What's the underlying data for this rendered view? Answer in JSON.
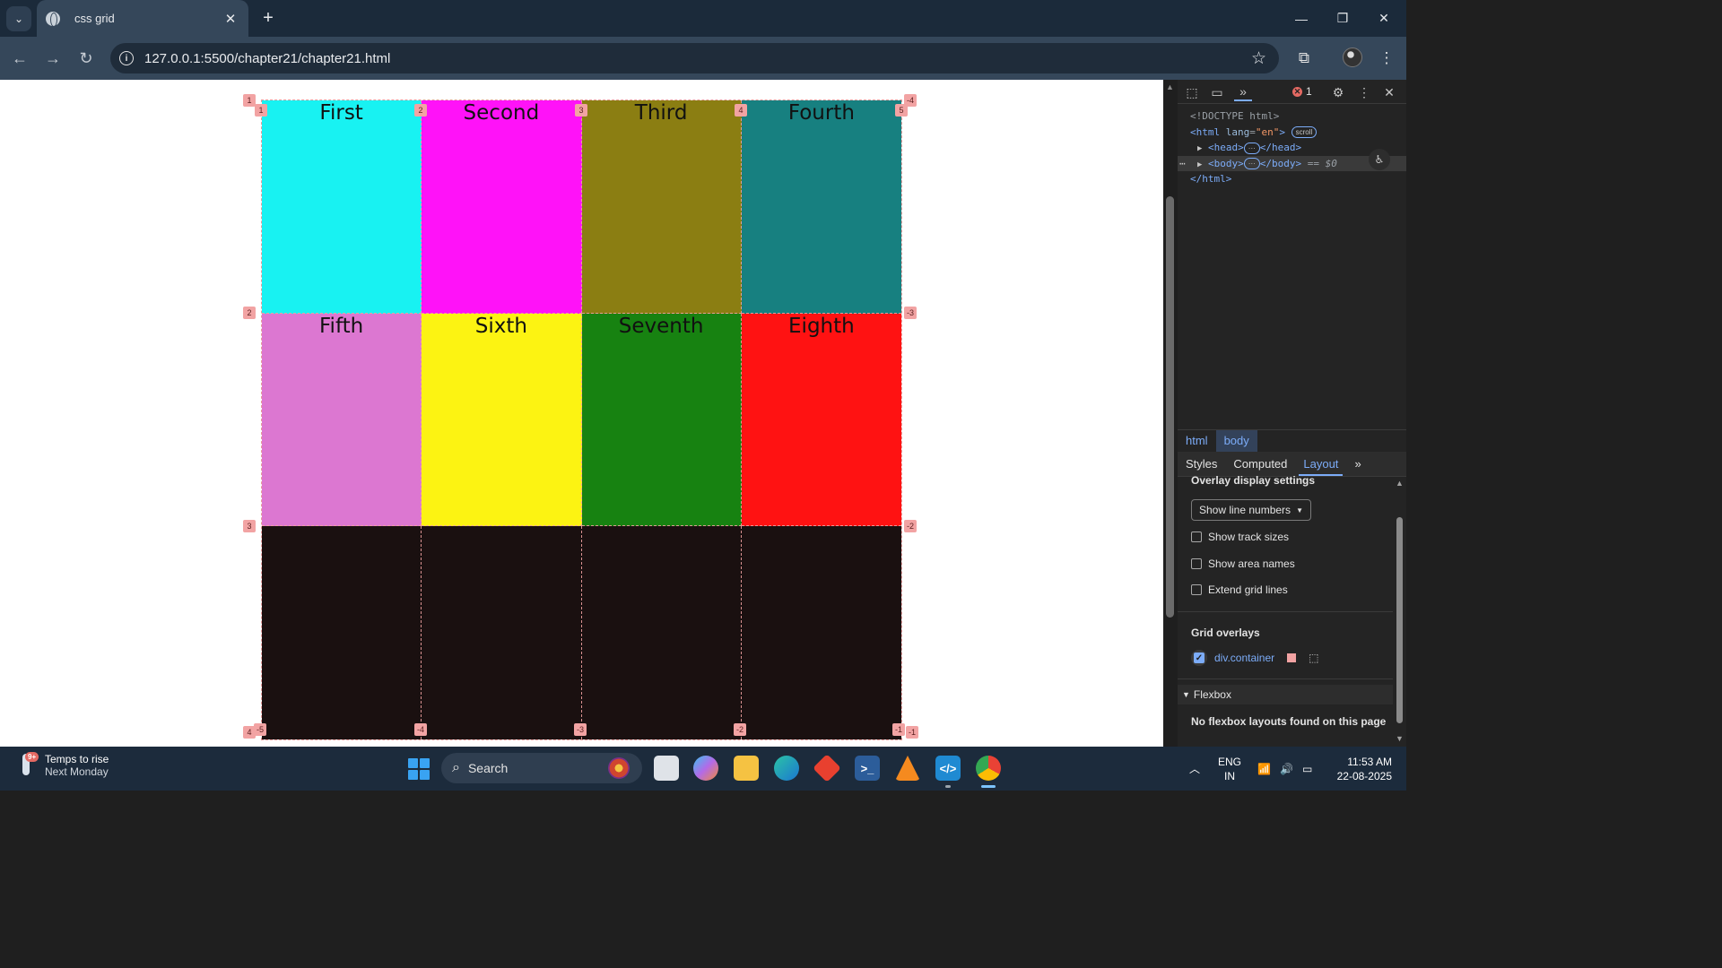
{
  "browser": {
    "tab_title": "css grid",
    "url": "127.0.0.1:5500/chapter21/chapter21.html"
  },
  "page": {
    "cells": [
      {
        "label": "First",
        "color": "#18f2f2"
      },
      {
        "label": "Second",
        "color": "#ff12f8"
      },
      {
        "label": "Third",
        "color": "#8b7e12"
      },
      {
        "label": "Fourth",
        "color": "#178080"
      },
      {
        "label": "Fifth",
        "color": "#dc77d1"
      },
      {
        "label": "Sixth",
        "color": "#fcf312"
      },
      {
        "label": "Seventh",
        "color": "#178211"
      },
      {
        "label": "Eighth",
        "color": "#ff1212"
      }
    ],
    "grid_line_labels": {
      "top_columns": [
        "1",
        "2",
        "3",
        "4",
        "5"
      ],
      "bottom_columns": [
        "-5",
        "-4",
        "-3",
        "-2",
        "-1"
      ],
      "left_rows": [
        "1",
        "2",
        "3",
        "4"
      ],
      "right_rows": [
        "-4",
        "-3",
        "-2",
        "-1"
      ]
    }
  },
  "devtools": {
    "error_count": "1",
    "dom": {
      "doctype": "<!DOCTYPE html>",
      "html_open": "<html",
      "lang_attr": "lang",
      "lang_value": "\"en\"",
      "scroll_pill": "scroll",
      "head_open": "<head>",
      "head_close": "</head>",
      "body_open": "<body>",
      "body_close": "</body>",
      "selected_marker": "== $0",
      "html_close": "</html>",
      "ellipsis": "···",
      "gt": ">"
    },
    "breadcrumbs": [
      "html",
      "body"
    ],
    "subtabs": [
      "Styles",
      "Computed",
      "Layout"
    ],
    "layout": {
      "overlay_title": "Overlay display settings",
      "select_value": "Show line numbers",
      "checkboxes": [
        "Show track sizes",
        "Show area names",
        "Extend grid lines"
      ],
      "grid_overlays_title": "Grid overlays",
      "overlay_item": "div.container",
      "overlay_color": "#f2a3a3",
      "flexbox_title": "Flexbox",
      "flexbox_message": "No flexbox layouts found on this page"
    }
  },
  "taskbar": {
    "weather_line1": "Temps to rise",
    "weather_line2": "Next Monday",
    "weather_badge": "9+",
    "search_label": "Search",
    "lang_line1": "ENG",
    "lang_line2": "IN",
    "time": "11:53 AM",
    "date": "22-08-2025"
  }
}
